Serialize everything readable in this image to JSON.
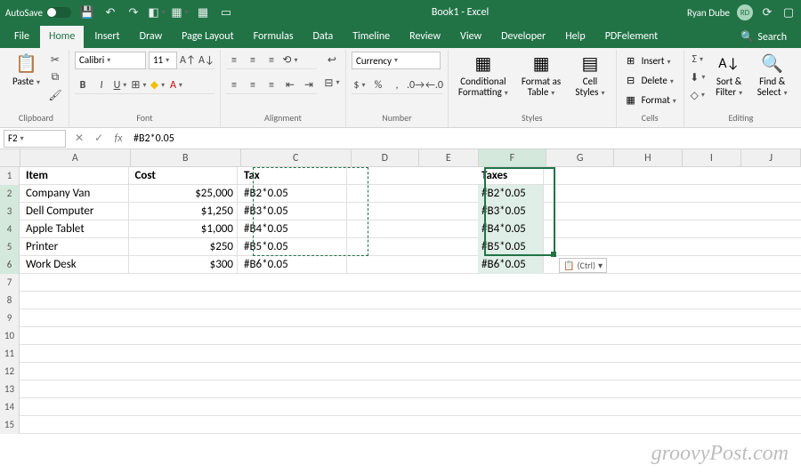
{
  "titlebar": {
    "autosave": "AutoSave",
    "title": "Book1 - Excel",
    "user": "Ryan Dube",
    "initials": "RD"
  },
  "tabs": {
    "file": "File",
    "home": "Home",
    "insert": "Insert",
    "draw": "Draw",
    "page_layout": "Page Layout",
    "formulas": "Formulas",
    "data": "Data",
    "timeline": "Timeline",
    "review": "Review",
    "view": "View",
    "developer": "Developer",
    "help": "Help",
    "pdfelement": "PDFelement",
    "search": "Search"
  },
  "ribbon": {
    "clipboard": {
      "paste": "Paste",
      "label": "Clipboard"
    },
    "font": {
      "name": "Calibri",
      "size": "11",
      "label": "Font"
    },
    "alignment": {
      "label": "Alignment"
    },
    "number": {
      "format": "Currency",
      "label": "Number"
    },
    "styles": {
      "cond": "Conditional Formatting",
      "table": "Format as Table",
      "cell": "Cell Styles",
      "label": "Styles"
    },
    "cells": {
      "insert": "Insert",
      "delete": "Delete",
      "format": "Format",
      "label": "Cells"
    },
    "editing": {
      "sort": "Sort & Filter",
      "find": "Find & Select",
      "label": "Editing"
    }
  },
  "formula_bar": {
    "name_box": "F2",
    "formula": "#B2*0.05"
  },
  "grid": {
    "columns": [
      "A",
      "B",
      "C",
      "D",
      "E",
      "F",
      "G",
      "H",
      "I",
      "J"
    ],
    "headers": {
      "A": "Item",
      "B": "Cost",
      "C": "Tax",
      "F": "Taxes"
    },
    "rows": [
      {
        "A": "Company Van",
        "B": "$25,000",
        "C": "#B2*0.05",
        "F": "#B2*0.05"
      },
      {
        "A": "Dell Computer",
        "B": "$1,250",
        "C": "#B3*0.05",
        "F": "#B3*0.05"
      },
      {
        "A": "Apple Tablet",
        "B": "$1,000",
        "C": "#B4*0.05",
        "F": "#B4*0.05"
      },
      {
        "A": "Printer",
        "B": "$250",
        "C": "#B5*0.05",
        "F": "#B5*0.05"
      },
      {
        "A": "Work Desk",
        "B": "$300",
        "C": "#B6*0.05",
        "F": "#B6*0.05"
      }
    ],
    "paste_options": "(Ctrl)"
  },
  "watermark": "groovyPost.com"
}
